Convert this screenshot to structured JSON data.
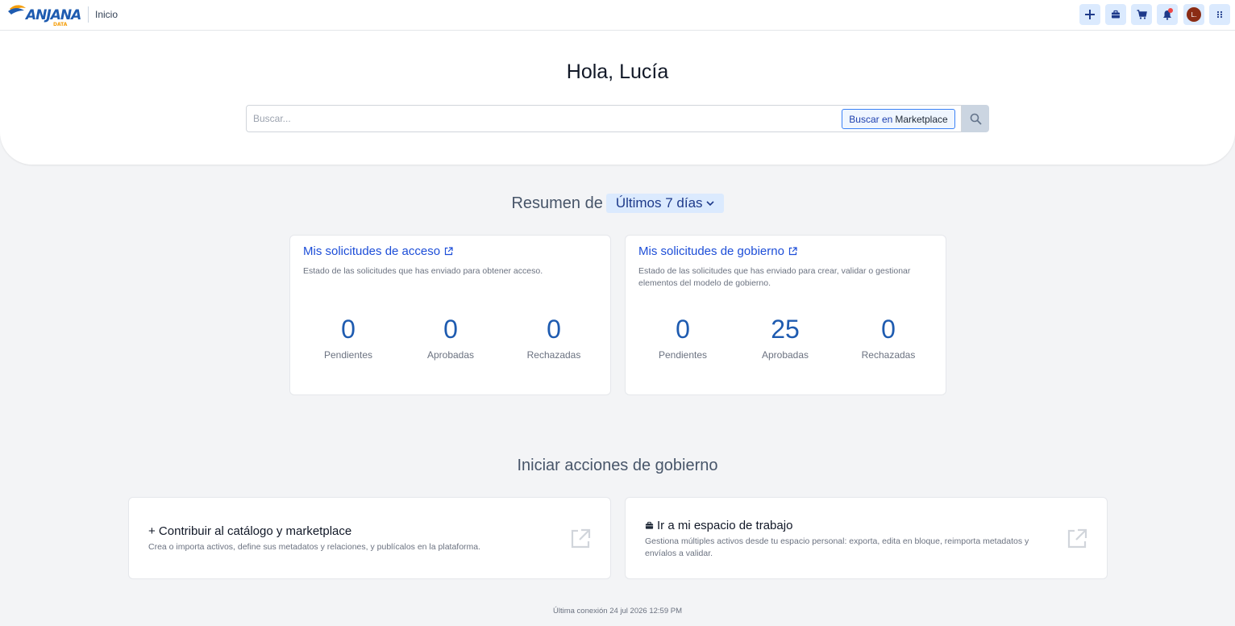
{
  "header": {
    "logo_text": "ANJANA",
    "logo_sub": "DATA",
    "breadcrumb": "Inicio",
    "avatar_initial": "L.",
    "icons": [
      "plus-icon",
      "briefcase-icon",
      "cart-icon",
      "bell-icon",
      "avatar",
      "apps-grid-icon"
    ]
  },
  "hero": {
    "greeting": "Hola, Lucía",
    "search_placeholder": "Buscar...",
    "marketplace_prefix": "Buscar en",
    "marketplace_label": "Marketplace"
  },
  "summary": {
    "prefix": "Resumen de",
    "period": "Últimos 7 días"
  },
  "cards": [
    {
      "title": "Mis solicitudes de acceso",
      "description": "Estado de las solicitudes que has enviado para obtener acceso.",
      "stats": [
        {
          "value": "0",
          "label": "Pendientes"
        },
        {
          "value": "0",
          "label": "Aprobadas"
        },
        {
          "value": "0",
          "label": "Rechazadas"
        }
      ]
    },
    {
      "title": "Mis solicitudes de gobierno",
      "description": "Estado de las solicitudes que has enviado para crear, validar o gestionar elementos del modelo de gobierno.",
      "stats": [
        {
          "value": "0",
          "label": "Pendientes"
        },
        {
          "value": "25",
          "label": "Aprobadas"
        },
        {
          "value": "0",
          "label": "Rechazadas"
        }
      ]
    }
  ],
  "actions": {
    "title": "Iniciar acciones de gobierno",
    "items": [
      {
        "title": "+ Contribuir al catálogo y marketplace",
        "description": "Crea o importa activos, define sus metadatos y relaciones, y publícalos en la plataforma."
      },
      {
        "title": "Ir a mi espacio de trabajo",
        "description": "Gestiona múltiples activos desde tu espacio personal: exporta, edita en bloque, reimporta metadatos y envíalos a validar."
      }
    ]
  },
  "footer": {
    "last_login": "Última conexión 24 jul 2026 12:59 PM"
  },
  "colors": {
    "accent": "#1d4ed8",
    "stat": "#1e5bb0",
    "annotation_arrow": "#f97316"
  }
}
